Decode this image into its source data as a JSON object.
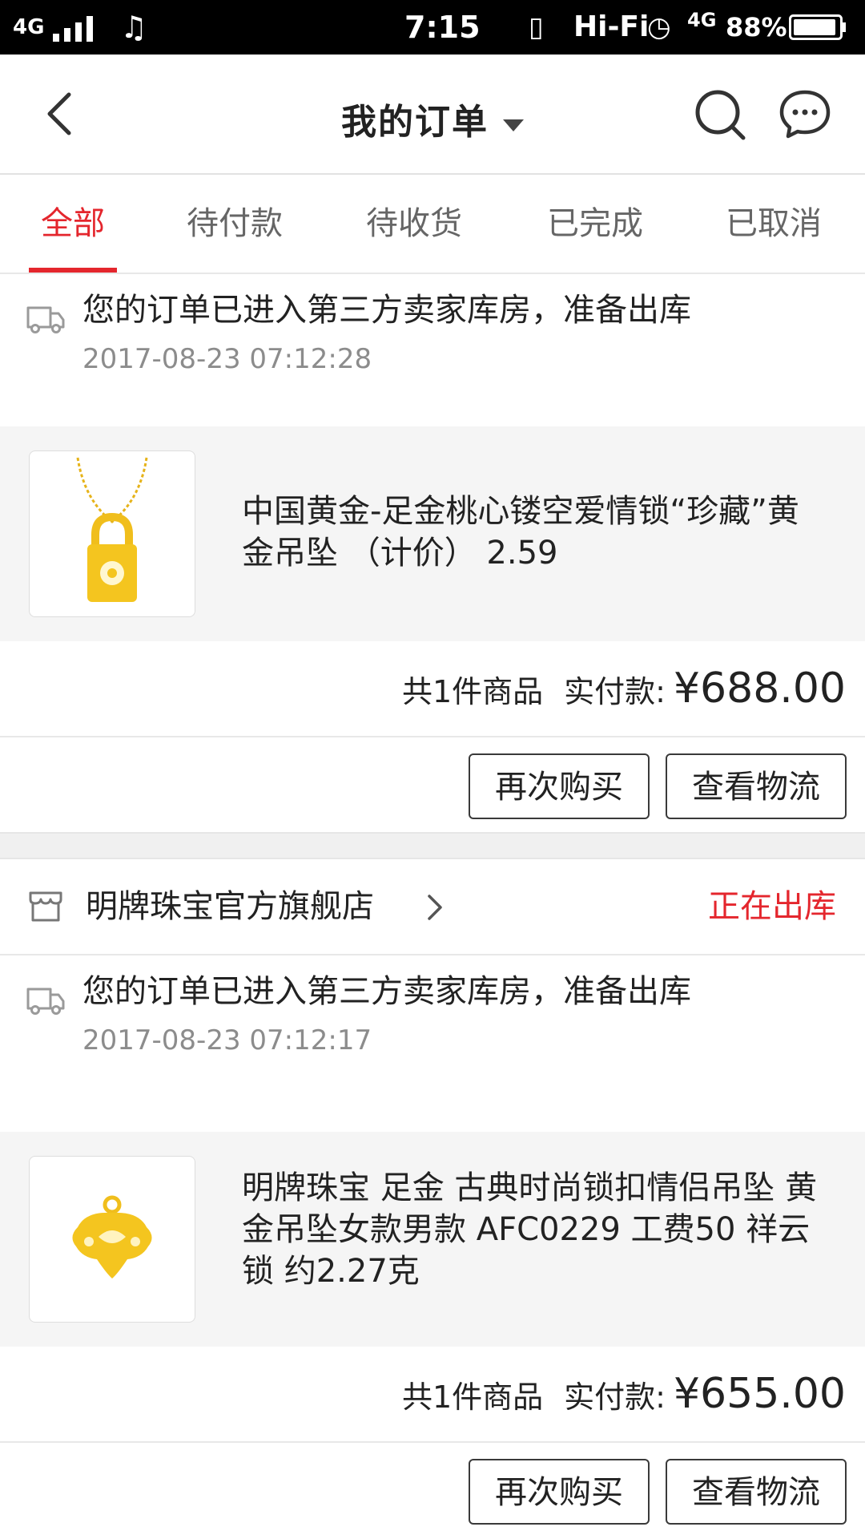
{
  "status_bar": {
    "network": "4G",
    "network2": "4G",
    "time": "7:15",
    "hifi": "Hi-Fi",
    "battery": "88%"
  },
  "header": {
    "title": "我的订单"
  },
  "tabs": [
    {
      "label": "全部"
    },
    {
      "label": "待付款"
    },
    {
      "label": "待收货"
    },
    {
      "label": "已完成"
    },
    {
      "label": "已取消"
    }
  ],
  "orders": [
    {
      "track_message": "您的订单已进入第三方卖家库房，准备出库",
      "track_time": "2017-08-23 07:12:28",
      "product_name": "中国黄金-足金桃心镂空爱情锁“珍藏”黄金吊坠 （计价） 2.59",
      "count_text": "共1件商品",
      "paid_label": "实付款:",
      "price": "¥688.00",
      "buy_again": "再次购买",
      "view_logistics": "查看物流"
    },
    {
      "shop_name": "明牌珠宝官方旗舰店",
      "shop_status": "正在出库",
      "track_message": "您的订单已进入第三方卖家库房，准备出库",
      "track_time": "2017-08-23 07:12:17",
      "product_name": "明牌珠宝 足金 古典时尚锁扣情侣吊坠 黄金吊坠女款男款 AFC0229 工费50 祥云锁 约2.27克",
      "count_text": "共1件商品",
      "paid_label": "实付款:",
      "price": "¥655.00",
      "buy_again": "再次购买",
      "view_logistics": "查看物流"
    }
  ],
  "colors": {
    "accent": "#e4262d",
    "gold": "#f2c21a"
  }
}
